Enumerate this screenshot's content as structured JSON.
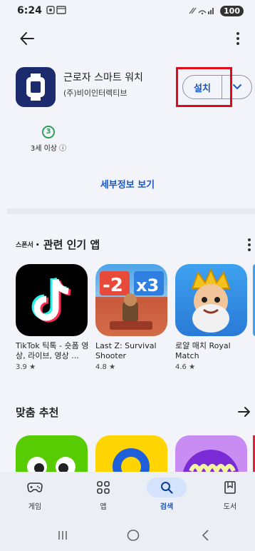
{
  "status_bar": {
    "time": "6:24",
    "battery": "100"
  },
  "app": {
    "name": "근로자 스마트 워치",
    "developer": "(주)비이인터렉티브"
  },
  "install": {
    "label": "설치"
  },
  "rating": {
    "age_number": "3",
    "age_label": "3세 이상 ⓘ"
  },
  "details_link": "세부정보 보기",
  "related": {
    "sponsor": "스폰서",
    "title": "· 관련 인기 앱",
    "apps": [
      {
        "title": "TikTok 틱톡 - 숏폼 영상, 라이브, 영상 ...",
        "rating": "3.9 ★"
      },
      {
        "title": "Last Z: Survival Shooter",
        "rating": "4.8 ★"
      },
      {
        "title": "로얄 매치 Royal Match",
        "rating": "4.6 ★"
      }
    ]
  },
  "recommended": {
    "title": "맞춤 추천"
  },
  "bottom_nav": {
    "items": [
      {
        "label": "게임"
      },
      {
        "label": "앱"
      },
      {
        "label": "검색"
      },
      {
        "label": "도서"
      }
    ]
  },
  "colors": {
    "accent": "#1a57c6",
    "highlight": "#e3071c",
    "age_badge": "#2e9e58"
  }
}
